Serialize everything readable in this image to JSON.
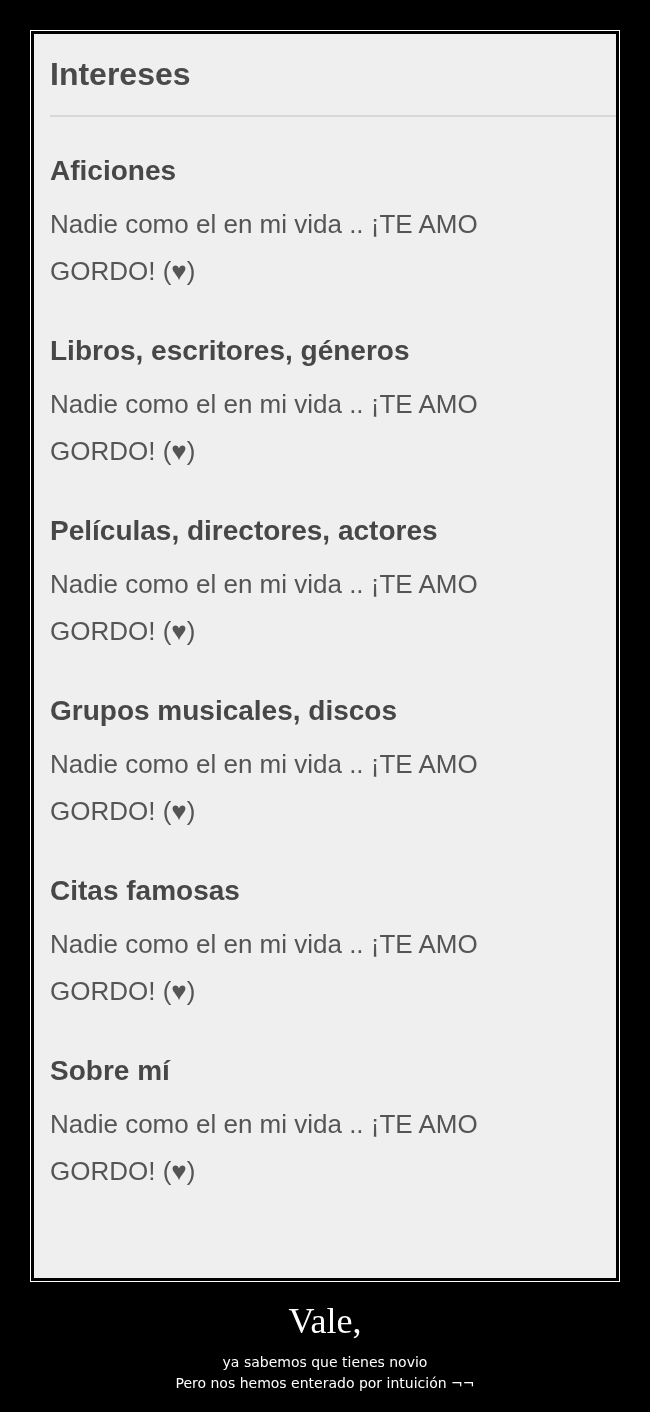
{
  "panel": {
    "title": "Intereses",
    "sections": [
      {
        "heading": "Aficiones",
        "text": "Nadie como el en mi vida .. ¡TE AMO GORDO! (♥)"
      },
      {
        "heading": "Libros, escritores, géneros",
        "text": "Nadie como el en mi vida .. ¡TE AMO GORDO! (♥)"
      },
      {
        "heading": "Películas, directores, actores",
        "text": "Nadie como el en mi vida .. ¡TE AMO GORDO! (♥)"
      },
      {
        "heading": "Grupos musicales, discos",
        "text": "Nadie como el en mi vida .. ¡TE AMO GORDO! (♥)"
      },
      {
        "heading": "Citas famosas",
        "text": "Nadie como el en mi vida .. ¡TE AMO GORDO! (♥)"
      },
      {
        "heading": "Sobre mí",
        "text": "Nadie como el en mi vida .. ¡TE AMO GORDO! (♥)"
      }
    ]
  },
  "caption": {
    "title": "Vale,",
    "lines": [
      "ya sabemos que tienes novio",
      "Pero nos hemos enterado por intuición ¬¬"
    ]
  }
}
